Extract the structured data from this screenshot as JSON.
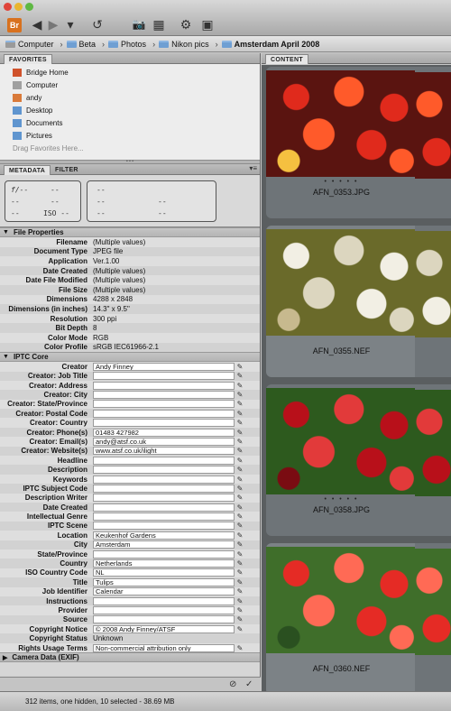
{
  "toolbar": {
    "app_logo": "Br",
    "back_icon": "◀",
    "forward_icon": "▶",
    "dropdown_icon": "▾",
    "rotate_icon": "↺",
    "camera_icon": "📷",
    "refine_icon": "▦",
    "sync_icon": "⚙",
    "open_icon": "▣"
  },
  "breadcrumb": [
    {
      "label": "Computer",
      "bold": false
    },
    {
      "label": "Beta",
      "bold": false
    },
    {
      "label": "Photos",
      "bold": false
    },
    {
      "label": "Nikon pics",
      "bold": false
    },
    {
      "label": "Amsterdam April 2008",
      "bold": true
    }
  ],
  "favorites": {
    "tab_label": "FAVORITES",
    "items": [
      {
        "label": "Bridge Home",
        "icon": "bridge-home-icon",
        "color": "#d0522b"
      },
      {
        "label": "Computer",
        "icon": "computer-icon",
        "color": "#a0a0a0"
      },
      {
        "label": "andy",
        "icon": "home-icon",
        "color": "#d97a3a"
      },
      {
        "label": "Desktop",
        "icon": "folder-icon",
        "color": "#5f95cf"
      },
      {
        "label": "Documents",
        "icon": "folder-icon",
        "color": "#5f95cf"
      },
      {
        "label": "Pictures",
        "icon": "folder-icon",
        "color": "#5f95cf"
      }
    ],
    "drag_hint": "Drag Favorites Here..."
  },
  "metadata_tabs": {
    "metadata": "METADATA",
    "filter": "FILTER"
  },
  "camera_box": {
    "fstop": "f/--",
    "exposure": "--",
    "r2c1": "--",
    "r2c2": "--",
    "r3c1": "--",
    "iso": "ISO --"
  },
  "camera_box2": {
    "a": "--",
    "b": "--",
    "c": "--",
    "d": "--",
    "e": "--"
  },
  "file_properties": {
    "title": "File Properties",
    "rows": [
      {
        "label": "Filename",
        "value": "(Multiple values)"
      },
      {
        "label": "Document Type",
        "value": "JPEG file"
      },
      {
        "label": "Application",
        "value": "Ver.1.00"
      },
      {
        "label": "Date Created",
        "value": "(Multiple values)"
      },
      {
        "label": "Date File Modified",
        "value": "(Multiple values)"
      },
      {
        "label": "File Size",
        "value": "(Multiple values)"
      },
      {
        "label": "Dimensions",
        "value": "4288 x 2848"
      },
      {
        "label": "Dimensions (in inches)",
        "value": "14.3\" x 9.5\""
      },
      {
        "label": "Resolution",
        "value": "300 ppi"
      },
      {
        "label": "Bit Depth",
        "value": "8"
      },
      {
        "label": "Color Mode",
        "value": "RGB"
      },
      {
        "label": "Color Profile",
        "value": "sRGB IEC61966-2.1"
      }
    ]
  },
  "iptc": {
    "title": "IPTC Core",
    "rows": [
      {
        "label": "Creator",
        "value": "Andy Finney",
        "editable": true
      },
      {
        "label": "Creator: Job Title",
        "value": "",
        "editable": true
      },
      {
        "label": "Creator: Address",
        "value": "",
        "editable": true
      },
      {
        "label": "Creator: City",
        "value": "",
        "editable": true
      },
      {
        "label": "Creator: State/Province",
        "value": "",
        "editable": true
      },
      {
        "label": "Creator: Postal Code",
        "value": "",
        "editable": true
      },
      {
        "label": "Creator: Country",
        "value": "",
        "editable": true
      },
      {
        "label": "Creator: Phone(s)",
        "value": "01483 427982",
        "editable": true
      },
      {
        "label": "Creator: Email(s)",
        "value": "andy@atsf.co.uk",
        "editable": true
      },
      {
        "label": "Creator: Website(s)",
        "value": "www.atsf.co.uk/ilight",
        "editable": true
      },
      {
        "label": "Headline",
        "value": "",
        "editable": true
      },
      {
        "label": "Description",
        "value": "",
        "editable": true
      },
      {
        "label": "Keywords",
        "value": "",
        "editable": true
      },
      {
        "label": "IPTC Subject Code",
        "value": "",
        "editable": true
      },
      {
        "label": "Description Writer",
        "value": "",
        "editable": true
      },
      {
        "label": "Date Created",
        "value": "",
        "editable": true
      },
      {
        "label": "Intellectual Genre",
        "value": "",
        "editable": true
      },
      {
        "label": "IPTC Scene",
        "value": "",
        "editable": true
      },
      {
        "label": "Location",
        "value": "Keukenhof Gardens",
        "editable": true
      },
      {
        "label": "City",
        "value": "Amsterdam",
        "editable": true
      },
      {
        "label": "State/Province",
        "value": "",
        "editable": true
      },
      {
        "label": "Country",
        "value": "Netherlands",
        "editable": true
      },
      {
        "label": "ISO Country Code",
        "value": "NL",
        "editable": true
      },
      {
        "label": "Title",
        "value": "Tulips",
        "editable": true
      },
      {
        "label": "Job Identifier",
        "value": "Calendar",
        "editable": true
      },
      {
        "label": "Instructions",
        "value": "",
        "editable": true
      },
      {
        "label": "Provider",
        "value": "",
        "editable": true
      },
      {
        "label": "Source",
        "value": "",
        "editable": true
      },
      {
        "label": "Copyright Notice",
        "value": "© 2008 Andy Finney/ATSF",
        "editable": true
      },
      {
        "label": "Copyright Status",
        "value": "Unknown",
        "editable": false
      },
      {
        "label": "Rights Usage Terms",
        "value": "Non-commercial attribution only",
        "editable": true
      }
    ]
  },
  "camera_data": {
    "title": "Camera Data (EXIF)"
  },
  "content": {
    "tab_label": "CONTENT",
    "thumbnails": [
      {
        "filename": "AFN_0353.JPG",
        "dots": "• • • • •",
        "selected": true,
        "palette": "red"
      },
      {
        "filename": "AFN_0355.NEF",
        "dots": "",
        "selected": false,
        "palette": "white"
      },
      {
        "filename": "AFN_0358.JPG",
        "dots": "• • • • •",
        "selected": true,
        "palette": "darkred"
      },
      {
        "filename": "AFN_0360.NEF",
        "dots": "",
        "selected": false,
        "palette": "red2"
      }
    ]
  },
  "status": {
    "text": "312 items, one hidden, 10 selected - 38.69 MB",
    "cancel_icon": "⊘",
    "apply_icon": "✓"
  }
}
